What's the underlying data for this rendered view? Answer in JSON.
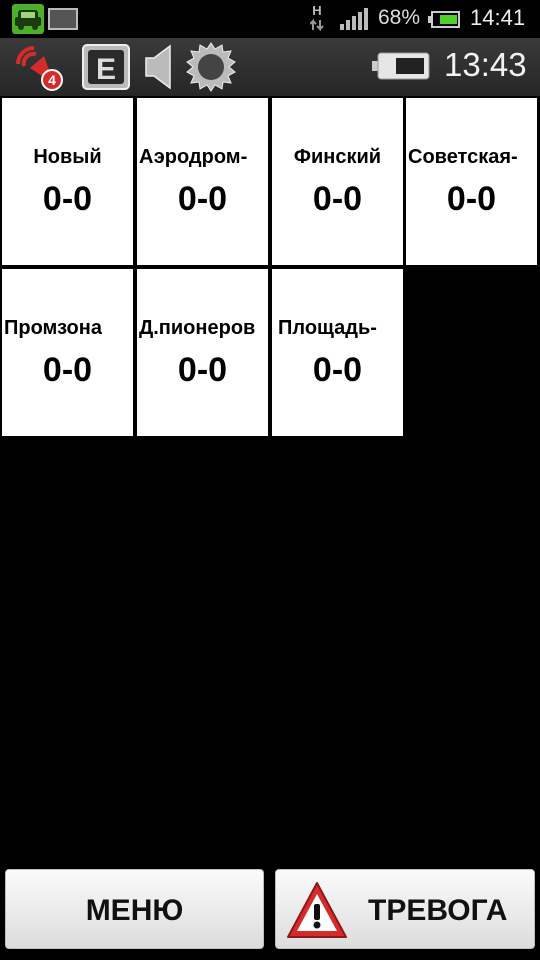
{
  "status_bar": {
    "network_type": "H",
    "battery_percent": "68%",
    "time": "14:41",
    "icons": [
      "taxi-app-icon",
      "sd-card-icon",
      "data-arrows-icon",
      "signal-icon",
      "battery-icon"
    ]
  },
  "toolbar": {
    "alert_badge_count": "4",
    "e_button_label": "E",
    "clock": "13:43",
    "icons": [
      "alert-icon",
      "e-icon",
      "speaker-icon",
      "gear-icon",
      "battery-icon"
    ]
  },
  "tiles": [
    {
      "name": "Новый",
      "count": "0-0"
    },
    {
      "name": "Аэродром-",
      "count": "0-0"
    },
    {
      "name": "Финский",
      "count": "0-0"
    },
    {
      "name": "Советская-",
      "count": "0-0"
    },
    {
      "name": "Промзона",
      "count": "0-0"
    },
    {
      "name": "Д.пионеров",
      "count": "0-0"
    },
    {
      "name": "Площадь-",
      "count": "0-0"
    }
  ],
  "bottom": {
    "menu_label": "МЕНЮ",
    "alarm_label": "ТРЕВОГА"
  },
  "colors": {
    "accent_red": "#d62b2b",
    "tile_bg": "#ffffff",
    "status_green": "#4caf2a"
  }
}
